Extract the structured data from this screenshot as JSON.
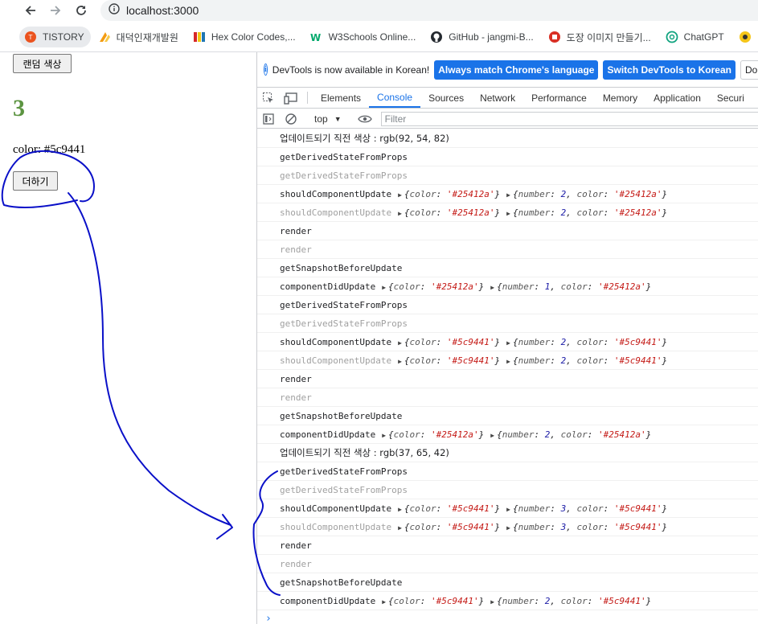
{
  "browser": {
    "url": "localhost:3000",
    "bookmarks": [
      {
        "label": "TISTORY",
        "icon": "tistory-icon",
        "color": "#eb531f"
      },
      {
        "label": "대덕인재개발원",
        "icon": "ddit-icon",
        "color": "#f39c12"
      },
      {
        "label": "Hex Color Codes,...",
        "icon": "hex-color-icon",
        "color": "#d62728"
      },
      {
        "label": "W3Schools Online...",
        "icon": "w3schools-icon",
        "color": "#04aa6d"
      },
      {
        "label": "GitHub - jangmi-B...",
        "icon": "github-icon",
        "color": "#24292f"
      },
      {
        "label": "도장 이미지 만들기...",
        "icon": "stamp-icon",
        "color": "#d93025"
      },
      {
        "label": "ChatGPT",
        "icon": "chatgpt-icon",
        "color": "#10a37f"
      },
      {
        "label": "",
        "icon": "extra-icon",
        "color": "#f5c518"
      }
    ]
  },
  "page": {
    "random_color_button": "랜덤 색상",
    "number": "3",
    "number_color": "#5c9441",
    "color_text": "color: #5c9441",
    "add_button": "더하기"
  },
  "devtools": {
    "infobar": {
      "message": "DevTools is now available in Korean!",
      "btn_match": "Always match Chrome's language",
      "btn_switch": "Switch DevTools to Korean",
      "btn_dont": "Don't sh"
    },
    "tabs": [
      "Elements",
      "Console",
      "Sources",
      "Network",
      "Performance",
      "Memory",
      "Application",
      "Securi"
    ],
    "active_tab": "Console",
    "context": "top",
    "filter_placeholder": "Filter",
    "logs": [
      {
        "text": "업데이트되기 직전 색상 : rgb(92, 54, 82)",
        "dim": false,
        "korean": true
      },
      {
        "text": "getDerivedStateFromProps",
        "dim": false
      },
      {
        "text": "getDerivedStateFromProps",
        "dim": true
      },
      {
        "text": "shouldComponentUpdate",
        "dim": false,
        "objs": [
          [
            [
              "color",
              "'#25412a'"
            ]
          ],
          [
            [
              "number",
              "2"
            ],
            [
              "color",
              "'#25412a'"
            ]
          ]
        ]
      },
      {
        "text": "shouldComponentUpdate",
        "dim": true,
        "objs": [
          [
            [
              "color",
              "'#25412a'"
            ]
          ],
          [
            [
              "number",
              "2"
            ],
            [
              "color",
              "'#25412a'"
            ]
          ]
        ]
      },
      {
        "text": "render",
        "dim": false
      },
      {
        "text": "render",
        "dim": true
      },
      {
        "text": "getSnapshotBeforeUpdate",
        "dim": false
      },
      {
        "text": "componentDidUpdate",
        "dim": false,
        "objs": [
          [
            [
              "color",
              "'#25412a'"
            ]
          ],
          [
            [
              "number",
              "1"
            ],
            [
              "color",
              "'#25412a'"
            ]
          ]
        ]
      },
      {
        "text": "getDerivedStateFromProps",
        "dim": false
      },
      {
        "text": "getDerivedStateFromProps",
        "dim": true
      },
      {
        "text": "shouldComponentUpdate",
        "dim": false,
        "objs": [
          [
            [
              "color",
              "'#5c9441'"
            ]
          ],
          [
            [
              "number",
              "2"
            ],
            [
              "color",
              "'#5c9441'"
            ]
          ]
        ]
      },
      {
        "text": "shouldComponentUpdate",
        "dim": true,
        "objs": [
          [
            [
              "color",
              "'#5c9441'"
            ]
          ],
          [
            [
              "number",
              "2"
            ],
            [
              "color",
              "'#5c9441'"
            ]
          ]
        ]
      },
      {
        "text": "render",
        "dim": false
      },
      {
        "text": "render",
        "dim": true
      },
      {
        "text": "getSnapshotBeforeUpdate",
        "dim": false
      },
      {
        "text": "componentDidUpdate",
        "dim": false,
        "objs": [
          [
            [
              "color",
              "'#25412a'"
            ]
          ],
          [
            [
              "number",
              "2"
            ],
            [
              "color",
              "'#25412a'"
            ]
          ]
        ]
      },
      {
        "text": "업데이트되기 직전 색상 : rgb(37, 65, 42)",
        "dim": false,
        "korean": true
      },
      {
        "text": "getDerivedStateFromProps",
        "dim": false
      },
      {
        "text": "getDerivedStateFromProps",
        "dim": true
      },
      {
        "text": "shouldComponentUpdate",
        "dim": false,
        "objs": [
          [
            [
              "color",
              "'#5c9441'"
            ]
          ],
          [
            [
              "number",
              "3"
            ],
            [
              "color",
              "'#5c9441'"
            ]
          ]
        ]
      },
      {
        "text": "shouldComponentUpdate",
        "dim": true,
        "objs": [
          [
            [
              "color",
              "'#5c9441'"
            ]
          ],
          [
            [
              "number",
              "3"
            ],
            [
              "color",
              "'#5c9441'"
            ]
          ]
        ]
      },
      {
        "text": "render",
        "dim": false
      },
      {
        "text": "render",
        "dim": true
      },
      {
        "text": "getSnapshotBeforeUpdate",
        "dim": false
      },
      {
        "text": "componentDidUpdate",
        "dim": false,
        "objs": [
          [
            [
              "color",
              "'#5c9441'"
            ]
          ],
          [
            [
              "number",
              "2"
            ],
            [
              "color",
              "'#5c9441'"
            ]
          ]
        ]
      }
    ],
    "prompt": "›"
  },
  "annotation": {
    "ink_color": "#0a10c8"
  }
}
